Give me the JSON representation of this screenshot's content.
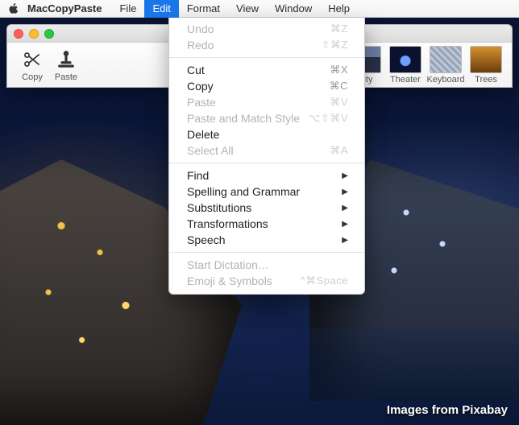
{
  "menubar": {
    "app_name": "MacCopyPaste",
    "items": [
      "File",
      "Edit",
      "Format",
      "View",
      "Window",
      "Help"
    ],
    "active_index": 1
  },
  "window": {
    "tools": [
      {
        "name": "Copy",
        "icon": "scissors-icon"
      },
      {
        "name": "Paste",
        "icon": "stamp-icon"
      }
    ],
    "thumbs": [
      {
        "label": "City",
        "style": "city"
      },
      {
        "label": "Theater",
        "style": "theater"
      },
      {
        "label": "Keyboard",
        "style": "keyboard"
      },
      {
        "label": "Trees",
        "style": "trees"
      }
    ]
  },
  "edit_menu": [
    {
      "label": "Undo",
      "shortcut": "⌘Z",
      "enabled": false
    },
    {
      "label": "Redo",
      "shortcut": "⇧⌘Z",
      "enabled": false
    },
    {
      "sep": true
    },
    {
      "label": "Cut",
      "shortcut": "⌘X",
      "enabled": true
    },
    {
      "label": "Copy",
      "shortcut": "⌘C",
      "enabled": true
    },
    {
      "label": "Paste",
      "shortcut": "⌘V",
      "enabled": false
    },
    {
      "label": "Paste and Match Style",
      "shortcut": "⌥⇧⌘V",
      "enabled": false
    },
    {
      "label": "Delete",
      "shortcut": "",
      "enabled": true
    },
    {
      "label": "Select All",
      "shortcut": "⌘A",
      "enabled": false
    },
    {
      "sep": true
    },
    {
      "label": "Find",
      "submenu": true,
      "enabled": true
    },
    {
      "label": "Spelling and Grammar",
      "submenu": true,
      "enabled": true
    },
    {
      "label": "Substitutions",
      "submenu": true,
      "enabled": true
    },
    {
      "label": "Transformations",
      "submenu": true,
      "enabled": true
    },
    {
      "label": "Speech",
      "submenu": true,
      "enabled": true
    },
    {
      "sep": true
    },
    {
      "label": "Start Dictation…",
      "shortcut": "",
      "enabled": false
    },
    {
      "label": "Emoji & Symbols",
      "shortcut": "^⌘Space",
      "enabled": false
    }
  ],
  "credit": "Images from Pixabay"
}
